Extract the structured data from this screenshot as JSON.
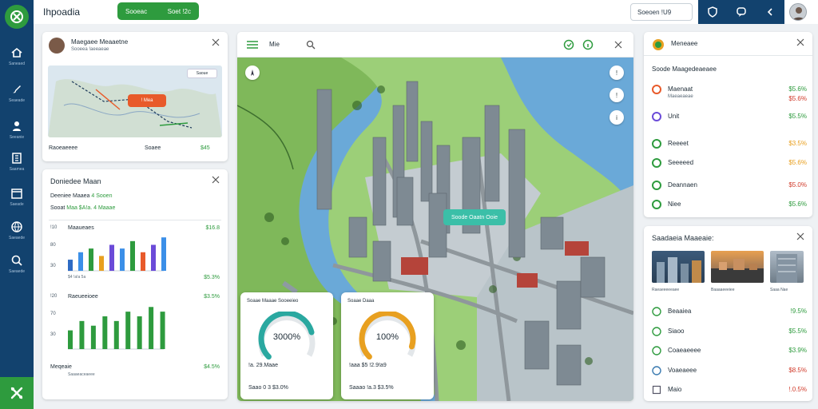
{
  "app": {
    "title": "Ihpoadia"
  },
  "rail": {
    "items": [
      {
        "icon": "home-icon",
        "label": "Saneaed"
      },
      {
        "icon": "brush-icon",
        "label": "Seaeade"
      },
      {
        "icon": "person-icon",
        "label": "Seeanie"
      },
      {
        "icon": "building-icon",
        "label": "Saamea"
      },
      {
        "icon": "calendar-icon",
        "label": "Saeade"
      },
      {
        "icon": "globe-icon",
        "label": "Saeaede"
      },
      {
        "icon": "search-icon",
        "label": "Saeaede"
      }
    ],
    "bottom_icon": "tools-icon"
  },
  "topbar": {
    "pill_left": "Sooeac",
    "pill_right": "Soet  !2c",
    "search_value": "Soeoen  !U9",
    "actions": [
      "shield-icon",
      "chat-icon",
      "share-icon"
    ]
  },
  "profile_card": {
    "name": "Maegaee Meaaetne",
    "subtitle": "Sooeea !aeeaeae",
    "map_badge": "! Mea",
    "map_tag": "Saoue",
    "footer_left": "Raoeaeeee",
    "footer_mid": "Soaee",
    "footer_right": "$45"
  },
  "stats_card": {
    "title": "Doniedee Maan",
    "line1_label": "Deeniee Maaea",
    "line1_value": "4 Sooen",
    "line2_label": "Sooat",
    "line2_value": "Maa  $A!a. 4  Maaae"
  },
  "chart_data": [
    {
      "type": "bar",
      "title": "Maaueaes",
      "value_label": "$16.8",
      "bottom_label": "$4 !a!a 5a",
      "bottom_value": "$5.3%",
      "y_ticks": [
        "!10",
        "80",
        "30"
      ],
      "values": [
        3,
        5,
        6,
        4,
        7,
        6,
        8,
        5,
        7,
        9
      ],
      "colors": [
        "#2e6bc4",
        "#3b8fe8",
        "#2e9b3e",
        "#e8a020",
        "#6b4bd8",
        "#3b8fe8",
        "#2e9b3e",
        "#e85a2a",
        "#6b4bd8",
        "#3b8fe8"
      ]
    },
    {
      "type": "bar",
      "title": "Raeueeioee",
      "value_label": "$3.5%",
      "bottom_label": "Meqeaie",
      "bottom_sub": "Saaaeaceaeee",
      "bottom_value": "$4.5%",
      "y_ticks": [
        "!20",
        "70",
        "30"
      ],
      "values": [
        4,
        6,
        5,
        7,
        6,
        8,
        7,
        9,
        8
      ],
      "colors": [
        "#2e9b3e",
        "#2e9b3e",
        "#2e9b3e",
        "#2e9b3e",
        "#2e9b3e",
        "#2e9b3e",
        "#2e9b3e",
        "#2e9b3e",
        "#2e9b3e"
      ]
    }
  ],
  "map": {
    "toolbar_text": "Mie",
    "label": "Soode Oaatn Ooie",
    "controls_right": [
      "!",
      "!",
      "i"
    ],
    "gauges": [
      {
        "title": "Soaae Maaae Sooeeieo",
        "value": "3000%",
        "line1": "!a.     29.Maae",
        "line2": "Saao 0 3 $3.0%",
        "percent": 0.78,
        "color": "#2aa8a0"
      },
      {
        "title": "Soaae Daaa",
        "value": "100%",
        "line1": "!aaa $5 !2.9!a9",
        "line2": "Saaao !a.3 $3.5%",
        "percent": 0.9,
        "color": "#e8a020"
      }
    ]
  },
  "right_card": {
    "title": "Meneaee",
    "section": "Soode Maagedeaeaee",
    "rows": [
      {
        "icon": "record-icon",
        "icon_color": "#e85a2a",
        "label": "Maenaat",
        "value": "$5.6%",
        "value_color": "#2e9b3e",
        "sub": "Maeaeaeae",
        "value2": "$5.6%",
        "value2_color": "#d13c2c"
      },
      {
        "icon": "heart-icon",
        "icon_color": "#6b4bd8",
        "label": "Unit",
        "value": "$5.5%",
        "value_color": "#2e9b3e"
      },
      {
        "icon": "flag-icon",
        "icon_color": "#2e9b3e",
        "label": "Reeeet",
        "value": "$3.5%",
        "value_color": "#e8a020"
      },
      {
        "icon": "diamond-icon",
        "icon_color": "#2e9b3e",
        "label": "Seeeeed",
        "value": "$5.6%",
        "value_color": "#e8a020"
      },
      {
        "icon": "leaf-icon",
        "icon_color": "#2e9b3e",
        "label": "Deannaen",
        "value": "$5.0%",
        "value_color": "#d13c2c"
      },
      {
        "icon": "list-icon",
        "icon_color": "#2e9b3e",
        "label": "Niee",
        "value": "$5.6%",
        "value_color": "#2e9b3e"
      }
    ]
  },
  "media_card": {
    "title": "Saadaeia Maaeaie:",
    "thumbs": [
      {
        "caption": "Raeaeeeeeaee"
      },
      {
        "caption": "Baaaaeeeiee"
      },
      {
        "caption": "Saaa  Nae"
      }
    ],
    "rows": [
      {
        "label": "Beaaiea",
        "value": "!9.5%",
        "value_color": "#2e9b3e"
      },
      {
        "label": "Siaoo",
        "value": "$5.5%",
        "value_color": "#2e9b3e"
      },
      {
        "label": "Coaeaeeee",
        "value": "$3.9%",
        "value_color": "#2e9b3e"
      },
      {
        "label": "Voaeaeee",
        "value": "$8.5%",
        "value_color": "#d13c2c"
      },
      {
        "label": "Maio",
        "value": "!.0.5%",
        "value_color": "#d13c2c"
      }
    ]
  }
}
